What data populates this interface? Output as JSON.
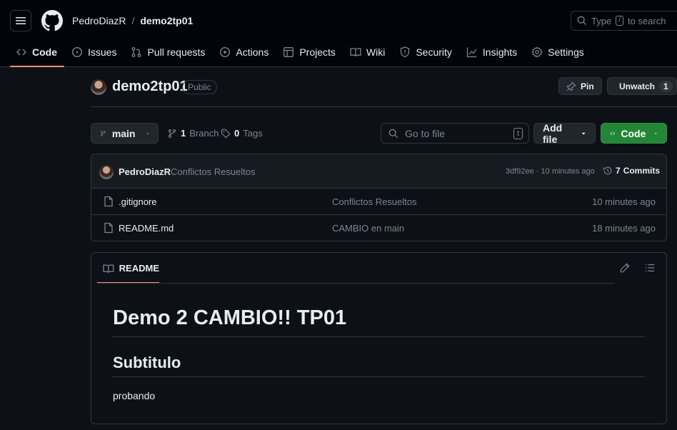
{
  "header": {
    "owner": "PedroDiazR",
    "separator": "/",
    "repo": "demo2tp01",
    "search": {
      "prefix": "Type",
      "key": "/",
      "suffix": "to search"
    }
  },
  "tabs": [
    {
      "label": "Code",
      "icon": "code-icon",
      "active": true
    },
    {
      "label": "Issues",
      "icon": "issue-icon"
    },
    {
      "label": "Pull requests",
      "icon": "pull-request-icon"
    },
    {
      "label": "Actions",
      "icon": "play-icon"
    },
    {
      "label": "Projects",
      "icon": "table-icon"
    },
    {
      "label": "Wiki",
      "icon": "book-icon"
    },
    {
      "label": "Security",
      "icon": "shield-icon"
    },
    {
      "label": "Insights",
      "icon": "graph-icon"
    },
    {
      "label": "Settings",
      "icon": "gear-icon"
    }
  ],
  "repo": {
    "name": "demo2tp01",
    "visibility": "Public",
    "pin_label": "Pin",
    "unwatch_label": "Unwatch",
    "watchers": "1"
  },
  "controls": {
    "branch": "main",
    "branches_count": "1",
    "branches_label": "Branch",
    "tags_count": "0",
    "tags_label": "Tags",
    "go_to_file_placeholder": "Go to file",
    "go_to_file_key": "t",
    "add_file_label": "Add file",
    "code_label": "Code"
  },
  "latest_commit": {
    "author": "PedroDiazR",
    "message": "Conflictos Resueltos",
    "sha_time": "3df92ee · 10 minutes ago",
    "commits_count": "7",
    "commits_label": "Commits"
  },
  "files": [
    {
      "name": ".gitignore",
      "message": "Conflictos Resueltos",
      "time": "10 minutes ago"
    },
    {
      "name": "README.md",
      "message": "CAMBIO en main",
      "time": "18 minutes ago"
    }
  ],
  "readme": {
    "tab_label": "README",
    "h1": "Demo 2 CAMBIO!! TP01",
    "h2": "Subtitulo",
    "paragraph": "probando"
  },
  "colors": {
    "background": "#0d1117",
    "header_bg": "#010409",
    "border": "#30363d",
    "accent_underline": "#fd8c73",
    "code_button": "#238636",
    "muted_text": "#7d8590"
  }
}
